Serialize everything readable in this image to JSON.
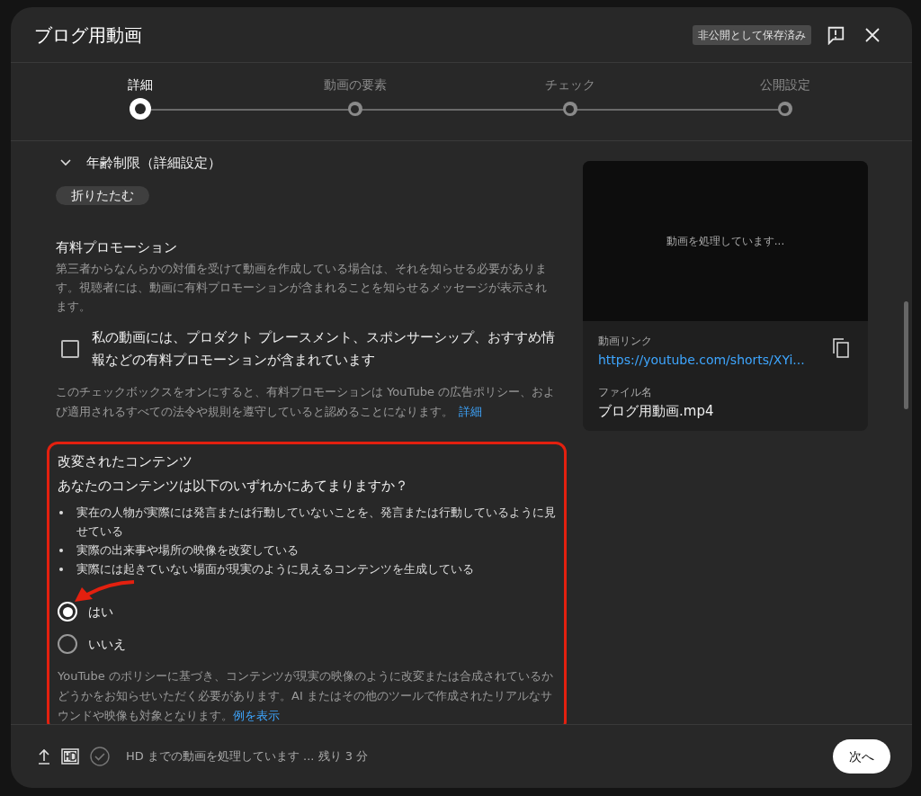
{
  "dialog": {
    "title": "ブログ用動画",
    "status_badge": "非公開として保存済み"
  },
  "steps": [
    {
      "label": "詳細",
      "selected": true
    },
    {
      "label": "動画の要素",
      "selected": false
    },
    {
      "label": "チェック",
      "selected": false
    },
    {
      "label": "公開設定",
      "selected": false
    }
  ],
  "age_restriction": {
    "label": "年齢制限（詳細設定）",
    "expanded": true,
    "collapse_button": "折りたたむ"
  },
  "paid_promotion": {
    "heading": "有料プロモーション",
    "description": "第三者からなんらかの対価を受けて動画を作成している場合は、それを知らせる必要があります。視聴者には、動画に有料プロモーションが含まれることを知らせるメッセージが表示されます。",
    "checkbox": {
      "label": "私の動画には、プロダクト プレースメント、スポンサーシップ、おすすめ情報などの有料プロモーションが含まれています",
      "checked": false
    },
    "note": "このチェックボックスをオンにすると、有料プロモーションは YouTube の広告ポリシー、および適用されるすべての法令や規則を遵守していると認めることになります。",
    "note_link": "詳細"
  },
  "altered_content": {
    "heading": "改変されたコンテンツ",
    "question": "あなたのコンテンツは以下のいずれかにあてまりますか？",
    "bullets": [
      "実在の人物が実際には発言または行動していないことを、発言または行動しているように見せている",
      "実際の出来事や場所の映像を改変している",
      "実際には起きていない場面が現実のように見えるコンテンツを生成している"
    ],
    "options": [
      {
        "label": "はい",
        "selected": true
      },
      {
        "label": "いいえ",
        "selected": false
      }
    ],
    "note": "YouTube のポリシーに基づき、コンテンツが現実の映像のように改変または合成されているかどうかをお知らせいただく必要があります。AI またはその他のツールで作成されたリアルなサウンドや映像も対象となります。",
    "note_link": "例を表示"
  },
  "video_card": {
    "preview_text": "動画を処理しています...",
    "link_label": "動画リンク",
    "link": "https://youtube.com/shorts/XYi...",
    "filename_label": "ファイル名",
    "filename": "ブログ用動画.mp4"
  },
  "footer": {
    "status": "HD までの動画を処理しています ... 残り 3 分",
    "next_button": "次へ"
  }
}
